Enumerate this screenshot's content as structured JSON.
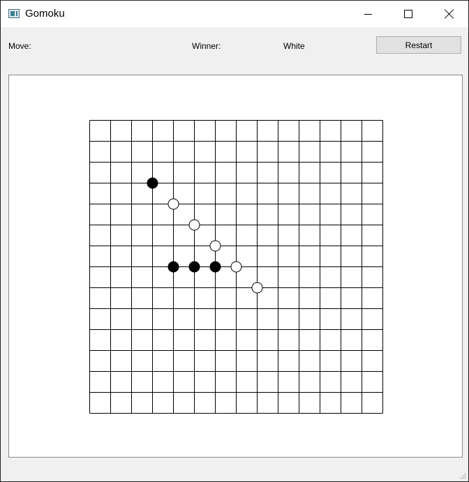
{
  "window": {
    "title": "Gomoku",
    "icon": "app-window-icon",
    "controls": [
      "minimize-icon",
      "maximize-icon",
      "close-icon"
    ]
  },
  "toolbar": {
    "move_label": "Move:",
    "move_value": "",
    "winner_label": "Winner:",
    "winner_value": "White",
    "restart_label": "Restart"
  },
  "board": {
    "columns": 14,
    "rows": 14,
    "line_color": "#000000",
    "background": "#ffffff",
    "stones": [
      {
        "color": "black",
        "col": 3,
        "row": 3
      },
      {
        "color": "white",
        "col": 4,
        "row": 4
      },
      {
        "color": "white",
        "col": 5,
        "row": 5
      },
      {
        "color": "white",
        "col": 6,
        "row": 6
      },
      {
        "color": "black",
        "col": 4,
        "row": 7
      },
      {
        "color": "black",
        "col": 5,
        "row": 7
      },
      {
        "color": "black",
        "col": 6,
        "row": 7
      },
      {
        "color": "white",
        "col": 7,
        "row": 7
      },
      {
        "color": "white",
        "col": 8,
        "row": 8
      }
    ]
  }
}
